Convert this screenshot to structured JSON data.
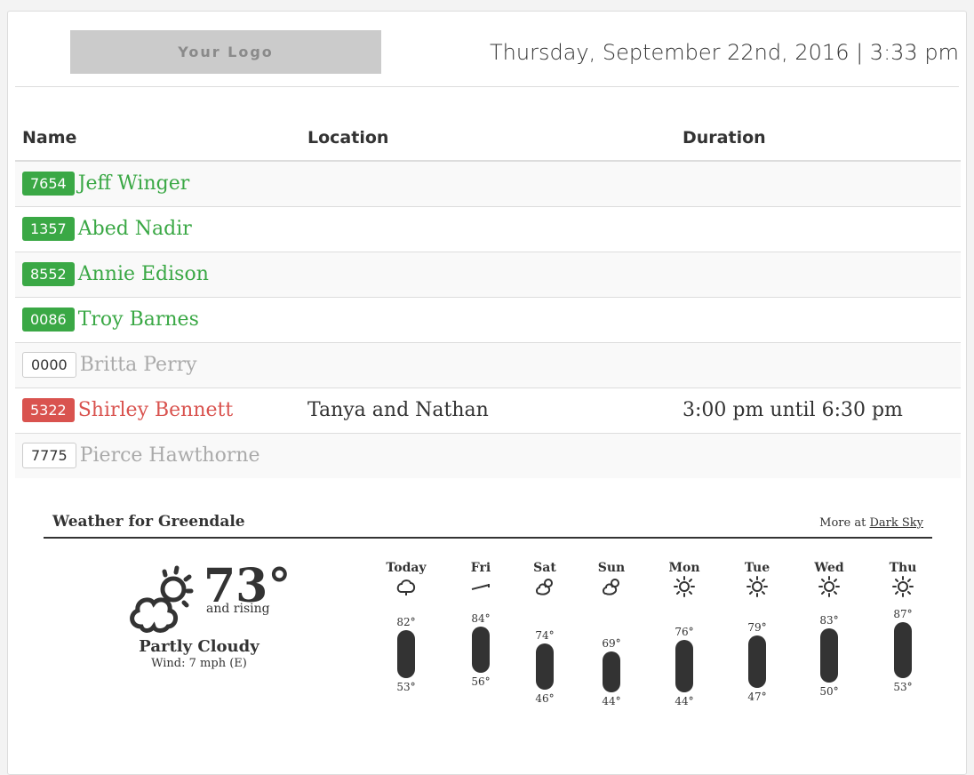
{
  "header": {
    "logo_text": "Your Logo",
    "datetime": "Thursday, September 22nd, 2016 | 3:33 pm"
  },
  "table": {
    "columns": [
      "Name",
      "Location",
      "Duration"
    ],
    "rows": [
      {
        "id": "7654",
        "name": "Jeff Winger",
        "status": "green",
        "location": "",
        "duration": ""
      },
      {
        "id": "1357",
        "name": "Abed Nadir",
        "status": "green",
        "location": "",
        "duration": ""
      },
      {
        "id": "8552",
        "name": "Annie Edison",
        "status": "green",
        "location": "",
        "duration": ""
      },
      {
        "id": "0086",
        "name": "Troy Barnes",
        "status": "green",
        "location": "",
        "duration": ""
      },
      {
        "id": "0000",
        "name": "Britta Perry",
        "status": "none",
        "location": "",
        "duration": ""
      },
      {
        "id": "5322",
        "name": "Shirley Bennett",
        "status": "red",
        "location": "Tanya and Nathan",
        "duration": "3:00 pm until 6:30 pm"
      },
      {
        "id": "7775",
        "name": "Pierce Hawthorne",
        "status": "none",
        "location": "",
        "duration": ""
      }
    ]
  },
  "colors": {
    "green": "#3aa845",
    "red": "#d9534f",
    "grey": "#aaaaaa"
  },
  "weather": {
    "title": "Weather for Greendale",
    "more_prefix": "More at",
    "more_link": "Dark Sky",
    "current": {
      "temp": "73°",
      "trend": "and rising",
      "condition": "Partly Cloudy",
      "wind": "Wind: 7 mph (E)",
      "icon": "partly-cloudy-icon"
    },
    "forecast": [
      {
        "day": "Today",
        "icon": "cloudy-icon",
        "high": 82,
        "low": 53
      },
      {
        "day": "Fri",
        "icon": "wind-icon",
        "high": 84,
        "low": 56
      },
      {
        "day": "Sat",
        "icon": "partly-cloudy-icon",
        "high": 74,
        "low": 46
      },
      {
        "day": "Sun",
        "icon": "partly-cloudy-icon",
        "high": 69,
        "low": 44
      },
      {
        "day": "Mon",
        "icon": "sun-icon",
        "high": 76,
        "low": 44
      },
      {
        "day": "Tue",
        "icon": "sun-icon",
        "high": 79,
        "low": 47
      },
      {
        "day": "Wed",
        "icon": "sun-icon",
        "high": 83,
        "low": 50
      },
      {
        "day": "Thu",
        "icon": "sun-icon",
        "high": 87,
        "low": 53
      }
    ]
  }
}
